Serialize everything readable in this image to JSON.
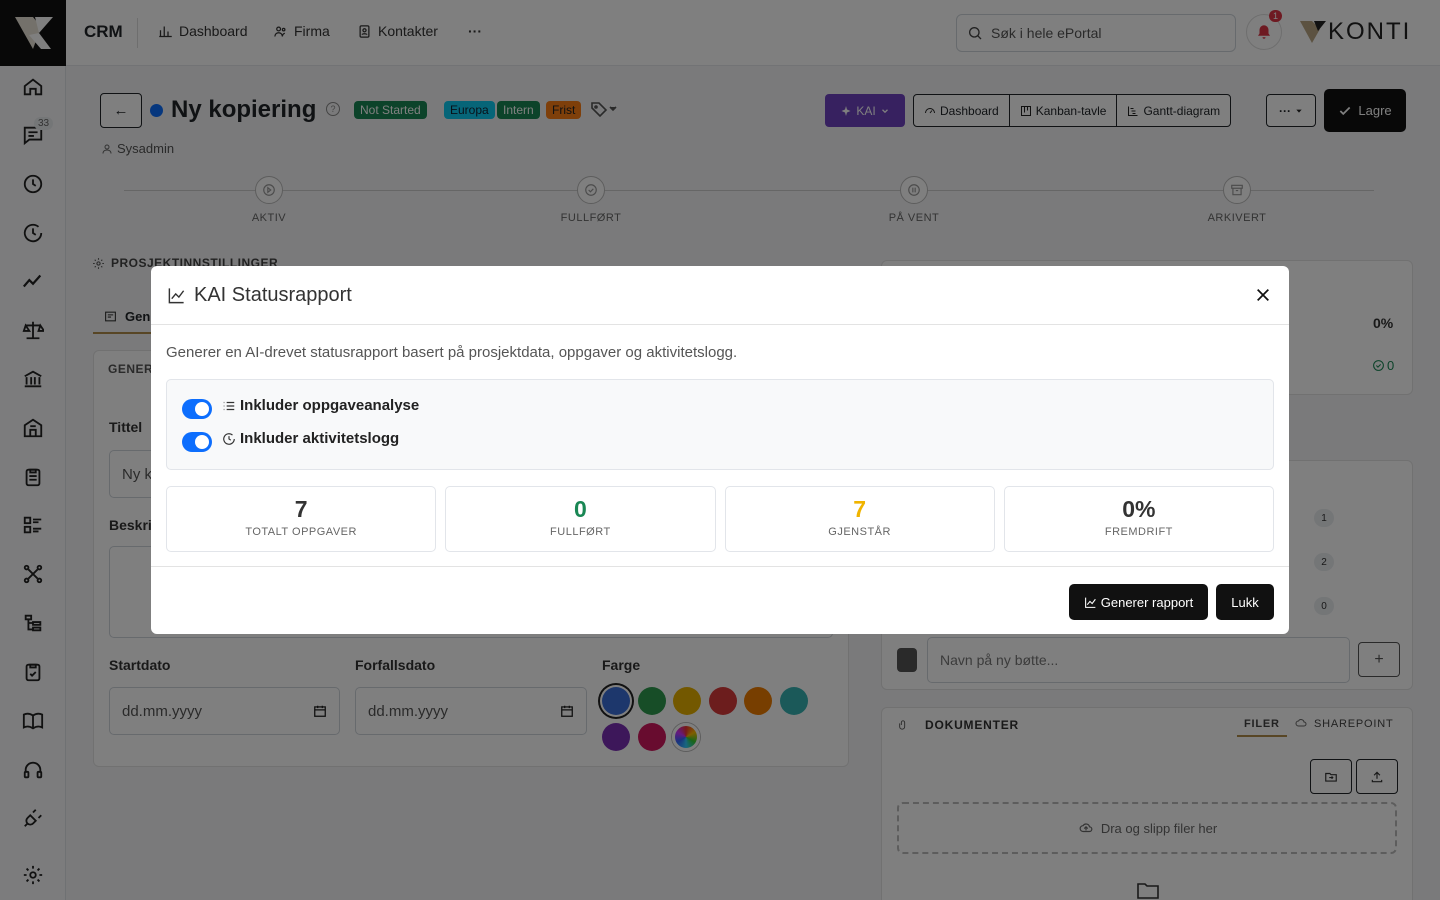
{
  "app": {
    "name": "CRM",
    "notification_count": "1",
    "brand": "KONTI"
  },
  "nav": {
    "dashboard": "Dashboard",
    "firma": "Firma",
    "kontakter": "Kontakter",
    "more": "···"
  },
  "search": {
    "placeholder": "Søk i hele ePortal"
  },
  "sidebar": {
    "messages_badge": "33"
  },
  "project": {
    "back": "←",
    "title": "Ny kopiering",
    "help": "?",
    "tags": [
      "Not Started",
      "Europa",
      "Intern",
      "Frist"
    ],
    "owner": "Sysadmin",
    "kai_button": "KAI",
    "views": [
      "Dashboard",
      "Kanban-tavle",
      "Gantt-diagram"
    ],
    "more": "···",
    "save": "Lagre"
  },
  "timeline": {
    "steps": [
      "AKTIV",
      "FULLFØRT",
      "PÅ VENT",
      "ARKIVERT"
    ]
  },
  "settings": {
    "heading": "PROSJEKTINNSTILLINGER",
    "tab_general": "Gen",
    "card_heading": "GENER",
    "title_label": "Tittel",
    "title_value": "Ny k",
    "description_label": "Beskri",
    "start_label": "Startdato",
    "due_label": "Forfallsdato",
    "color_label": "Farge",
    "date_placeholder": "dd.mm.yyyy",
    "colors": [
      "#3a6fd8",
      "#2e9b4e",
      "#e6b000",
      "#d83a3a",
      "#ef7d00",
      "#36b3b3",
      "#7b2fb5",
      "#d0195e"
    ]
  },
  "right_panel": {
    "progress": "0%",
    "completed_count": "0",
    "bucket_counts": [
      "1",
      "2",
      "0"
    ],
    "bucket_placeholder": "Navn på ny bøtte...",
    "add": "+",
    "documents": "DOKUMENTER",
    "files_tab": "FILER",
    "sharepoint_tab": "SHAREPOINT",
    "dropzone": "Dra og slipp filer her"
  },
  "modal": {
    "title": "KAI Statusrapport",
    "intro": "Generer en AI-drevet statusrapport basert på prosjektdata, oppgaver og aktivitetslogg.",
    "option_tasks": "Inkluder oppgaveanalyse",
    "option_activity": "Inkluder aktivitetslogg",
    "stats": [
      {
        "value": "7",
        "label": "TOTALT OPPGAVER",
        "color": "#333333"
      },
      {
        "value": "0",
        "label": "FULLFØRT",
        "color": "#198754"
      },
      {
        "value": "7",
        "label": "GJENSTÅR",
        "color": "#f0b400"
      },
      {
        "value": "0%",
        "label": "FREMDRIFT",
        "color": "#333333"
      }
    ],
    "generate": "Generer rapport",
    "close": "Lukk"
  },
  "colors": {
    "kai_purple": "#6f42c1",
    "accent_blue": "#0d6efd",
    "dark": "#111111"
  }
}
